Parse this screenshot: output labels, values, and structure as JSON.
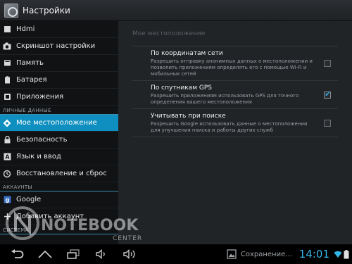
{
  "action_bar": {
    "title": "Настройки",
    "icon": "settings-app-icon"
  },
  "sidebar": {
    "items_top": [
      {
        "label": "Hdmi",
        "icon": "hdmi-icon"
      },
      {
        "label": "Скриншот настройки",
        "icon": "camera-icon"
      },
      {
        "label": "Память",
        "icon": "storage-icon"
      },
      {
        "label": "Батарея",
        "icon": "battery-icon"
      },
      {
        "label": "Приложения",
        "icon": "apps-icon"
      }
    ],
    "section_personal": "ЛИЧНЫЕ ДАННЫЕ",
    "items_personal": [
      {
        "label": "Мое местоположение",
        "icon": "location-icon",
        "active": true
      },
      {
        "label": "Безопасность",
        "icon": "lock-icon"
      },
      {
        "label": "Язык и ввод",
        "icon": "language-icon"
      },
      {
        "label": "Восстановление и сброс",
        "icon": "backup-icon"
      }
    ],
    "section_accounts": "АККАУНТЫ",
    "items_accounts": [
      {
        "label": "Google",
        "icon": "google-icon"
      },
      {
        "label": "Добавить аккаунт",
        "icon": "plus-icon"
      }
    ],
    "section_system": "СИСТЕМА"
  },
  "detail": {
    "title": "Мое местоположение",
    "prefs": [
      {
        "name": "По координатам сети",
        "summary": "Разрешить отправку анонимных данных о местоположении и позволить приложениям определять его с помощью Wi-Fi и мобильных сетей",
        "checked": false
      },
      {
        "name": "По спутникам GPS",
        "summary": "Разрешить приложениям использовать GPS для точного определения вашего местоположения",
        "checked": true
      },
      {
        "name": "Учитывать при поиске",
        "summary": "Разрешить Google использовать данные о местоположении для улучшения поиска и работы других служб",
        "checked": false
      }
    ]
  },
  "watermark": {
    "line1": "NOTEBOOK",
    "line2": "CENTER"
  },
  "system_bar": {
    "notification_text": "Сохранение...",
    "clock": "14:01",
    "nav": [
      "back-icon",
      "home-icon",
      "recent-apps-icon",
      "volume-down-icon",
      "volume-up-icon"
    ]
  },
  "colors": {
    "accent": "#0f8fbf",
    "clock": "#33b5e5",
    "check": "#2aa3d8"
  }
}
